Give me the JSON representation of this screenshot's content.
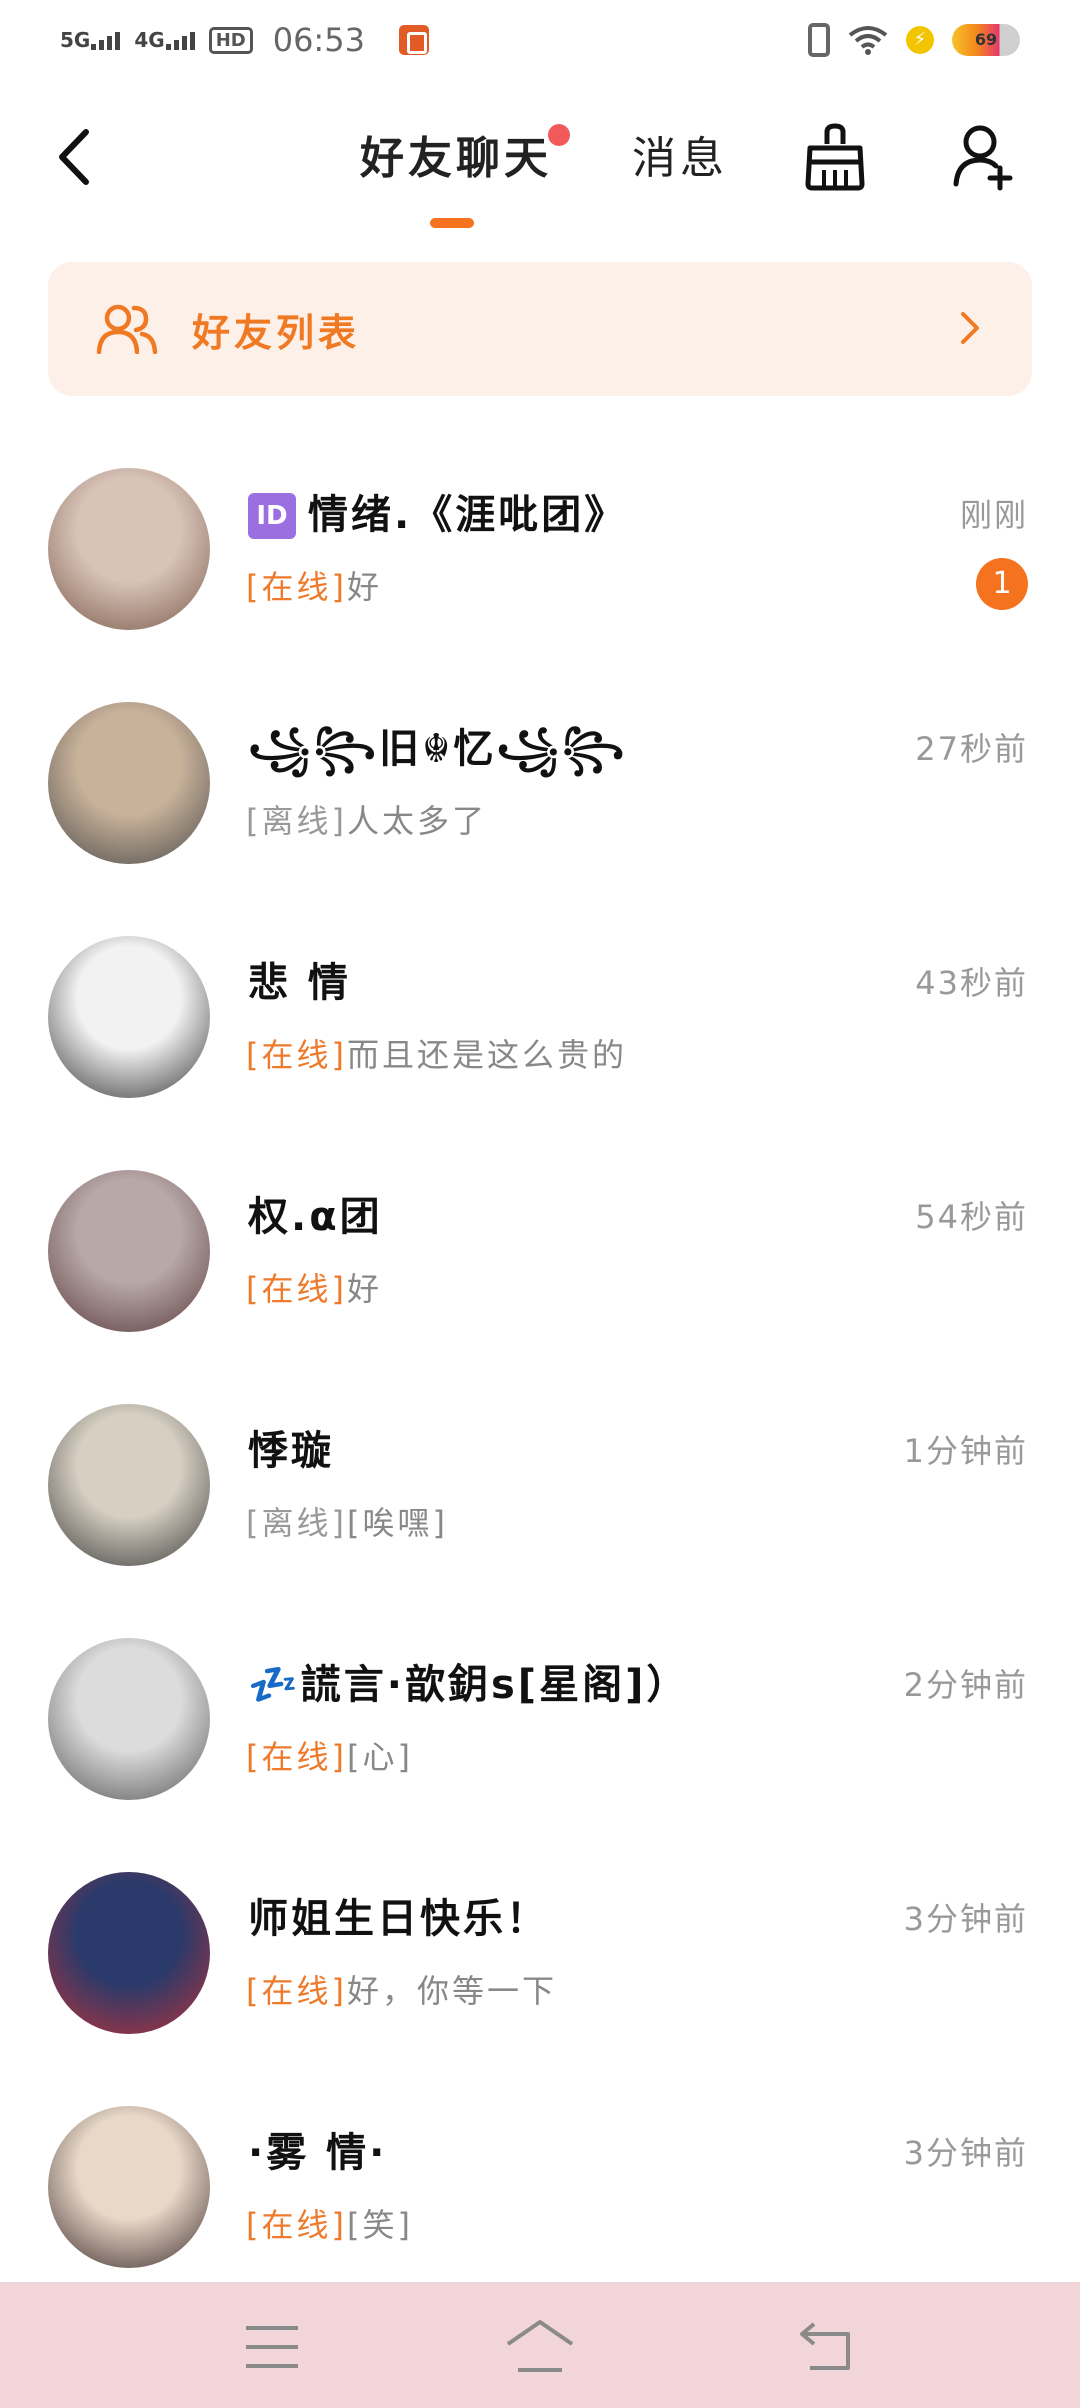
{
  "status_bar": {
    "net1": "5G",
    "net2": "4G",
    "hd": "HD",
    "time": "06:53",
    "battery": "69"
  },
  "top_nav": {
    "tab_friends_chat": "好友聊天",
    "tab_messages": "消息",
    "accent_color": "#f5731f"
  },
  "friend_list_banner": {
    "label": "好友列表"
  },
  "chats": [
    {
      "name": "情绪.《涯吡团》",
      "id_badge": "ID",
      "time": "刚刚",
      "status": "[在线]",
      "online": true,
      "message": "好",
      "unread": "1",
      "avatar_colors": [
        "#d8c3b8",
        "#7a5a4a"
      ]
    },
    {
      "name": "꧁꧂旧☬忆꧁꧂",
      "time": "27秒前",
      "status": "[离线]",
      "online": false,
      "message": "人太多了",
      "avatar_colors": [
        "#c9b29a",
        "#4a4a4a"
      ]
    },
    {
      "name": "悲 情",
      "time": "43秒前",
      "status": "[在线]",
      "online": true,
      "message": "而且还是这么贵的",
      "avatar_colors": [
        "#f2f2f2",
        "#333333"
      ]
    },
    {
      "name": "权.α团",
      "time": "54秒前",
      "status": "[在线]",
      "online": true,
      "message": "好",
      "avatar_colors": [
        "#b8a8a8",
        "#5a3a3a"
      ]
    },
    {
      "name": "悸璇",
      "time": "1分钟前",
      "status": "[离线]",
      "online": false,
      "message": "[唉嘿]",
      "avatar_colors": [
        "#d6cfc2",
        "#3a3a3a"
      ]
    },
    {
      "name": "💤謊言·歆鈅s[星阁]）",
      "time": "2分钟前",
      "status": "[在线]",
      "online": true,
      "message": "[心]",
      "avatar_colors": [
        "#dcdcdc",
        "#555555"
      ]
    },
    {
      "name": "师姐生日快乐！",
      "time": "3分钟前",
      "status": "[在线]",
      "online": true,
      "message": "好，你等一下",
      "avatar_colors": [
        "#2a3a6a",
        "#b8323a"
      ]
    },
    {
      "name": "·雾 情·",
      "time": "3分钟前",
      "status": "[在线]",
      "online": true,
      "message": "[笑]",
      "avatar_colors": [
        "#e8d8c8",
        "#3a2a2a"
      ]
    }
  ]
}
